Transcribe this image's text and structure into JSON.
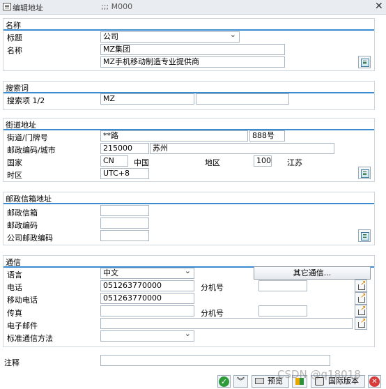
{
  "window": {
    "title": "编辑地址",
    "subtitle": ";;;  M000",
    "close_label": "✕"
  },
  "name_section": {
    "header": "名称",
    "title_label": "标题",
    "title_value": "公司",
    "name_label": "名称",
    "name1": "MZ集团",
    "name2": "MZ手机移动制造专业提供商"
  },
  "search_section": {
    "header": "搜索词",
    "term_label": "搜索项 1/2",
    "term1": "MZ",
    "term2": ""
  },
  "street_section": {
    "header": "街道地址",
    "street_label": "街道/门牌号",
    "street": "**路",
    "house_no": "888号",
    "postcode_label": "邮政编码/城市",
    "postcode": "215000",
    "city": "苏州",
    "country_label": "国家",
    "country_code": "CN",
    "country_name": "中国",
    "region_label": "地区",
    "region_code": "100",
    "region_name": "江苏",
    "timezone_label": "时区",
    "timezone": "UTC+8"
  },
  "pobox_section": {
    "header": "邮政信箱地址",
    "pobox_label": "邮政信箱",
    "pobox": "",
    "postcode_label": "邮政编码",
    "postcode": "",
    "company_postcode_label": "公司邮政编码",
    "company_postcode": ""
  },
  "comm_section": {
    "header": "通信",
    "language_label": "语言",
    "language": "中文",
    "other_comm_button": "其它通信...",
    "phone_label": "电话",
    "phone": "051263770000",
    "ext_label": "分机号",
    "phone_ext": "",
    "mobile_label": "移动电话",
    "mobile": "051263770000",
    "fax_label": "传真",
    "fax": "",
    "fax_ext_label": "分机号",
    "fax_ext": "",
    "email_label": "电子邮件",
    "email": "",
    "std_method_label": "标准通信方法",
    "std_method": ""
  },
  "notes": {
    "label": "注释",
    "value": ""
  },
  "toolbar": {
    "preview_label": "预览",
    "intl_label": "国际版本"
  },
  "watermark": "CSDN @q18018"
}
